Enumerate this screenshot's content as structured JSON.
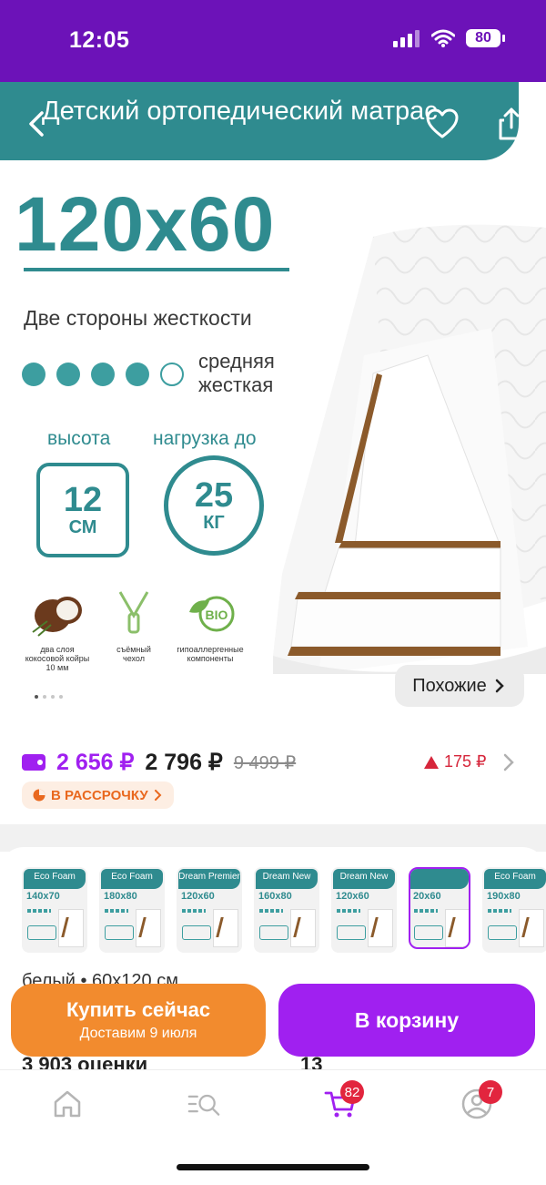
{
  "status_bar": {
    "time": "12:05",
    "battery": "80"
  },
  "product_image": {
    "banner_title": "Детский ортопедический матрас",
    "size": "120x60",
    "sides_text": "Две стороны жесткости",
    "stiffness_level": 4,
    "stiffness_max": 5,
    "stiffness_label_line1": "средняя",
    "stiffness_label_line2": "жесткая",
    "height_label": "высота",
    "height_value": "12",
    "height_unit": "СМ",
    "load_label": "нагрузка до",
    "load_value": "25",
    "load_unit": "КГ",
    "features": [
      {
        "icon": "coconut-icon",
        "line1": "два слоя",
        "line2": "кокосовой койры",
        "line3": "10 мм"
      },
      {
        "icon": "zipper-icon",
        "line1": "съёмный",
        "line2": "чехол",
        "line3": ""
      },
      {
        "icon": "bio-icon",
        "line1": "гипоаллергенные",
        "line2": "компоненты",
        "line3": ""
      }
    ],
    "carousel_total": 4,
    "carousel_active": 1,
    "similar_button": "Похожие"
  },
  "price": {
    "card_price": "2 656 ₽",
    "current_price": "2 796 ₽",
    "old_price": "9 499 ₽",
    "price_drop": "175 ₽",
    "installment": "В РАССРОЧКУ"
  },
  "variants": [
    {
      "brand": "Eco Foam",
      "size": "140x70",
      "selected": false
    },
    {
      "brand": "Eco Foam",
      "size": "180x80",
      "selected": false
    },
    {
      "brand": "Dream Premier",
      "size": "120x60",
      "selected": false
    },
    {
      "brand": "Dream New",
      "size": "160x80",
      "selected": false
    },
    {
      "brand": "Dream New",
      "size": "120x60",
      "selected": false
    },
    {
      "brand": "",
      "size": "20x60",
      "selected": true
    },
    {
      "brand": "Eco Foam",
      "size": "190x80",
      "selected": false
    }
  ],
  "variant_selected_text": "белый • 60x120 см",
  "ratings_peek": "3 903 оценки",
  "peek_number": "13",
  "actions": {
    "buy_now": "Купить сейчас",
    "delivery": "Доставим 9 июля",
    "add_to_cart": "В корзину"
  },
  "tabbar": {
    "cart_badge": "82",
    "profile_badge": "7"
  },
  "colors": {
    "brand_purple": "#a020f0",
    "status_purple": "#6c12b8",
    "teal": "#2f8b8f",
    "orange": "#f28b2e",
    "red": "#d6263b"
  }
}
